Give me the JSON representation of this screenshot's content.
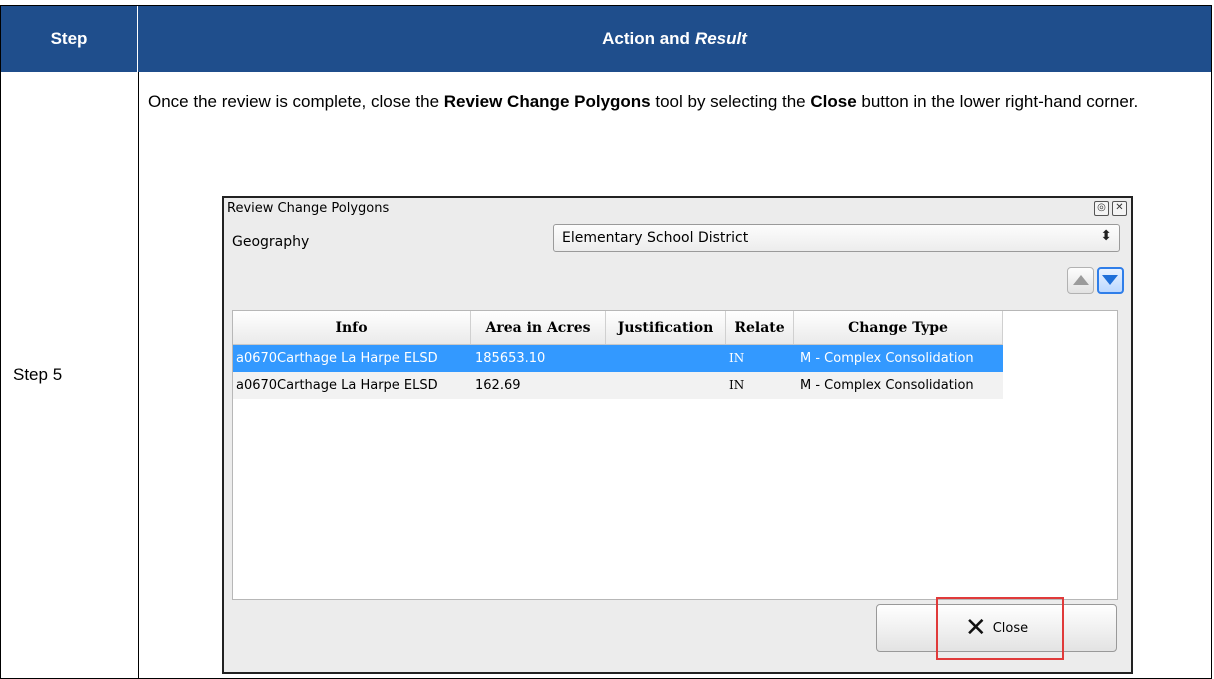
{
  "header": {
    "step_label": "Step",
    "action_label": "Action and",
    "result_label": "Result"
  },
  "row": {
    "step": "Step 5",
    "instruction": {
      "part1": "Once the review is complete, close the ",
      "bold1": "Review Change Polygons",
      "part2": " tool by selecting the ",
      "bold2": "Close",
      "part3": " button in the lower right-hand corner."
    }
  },
  "dialog": {
    "title": "Review Change Polygons",
    "controls": [
      "float-icon",
      "close-icon"
    ],
    "geography": {
      "label": "Geography",
      "value": "Elementary School District"
    },
    "table": {
      "columns": [
        "Info",
        "Area in Acres",
        "Justification",
        "Relate",
        "Change Type"
      ],
      "rows": [
        {
          "info": "a0670Carthage La Harpe ELSD",
          "area": "185653.10",
          "justification": "",
          "relate": "IN",
          "change_type": "M - Complex Consolidation",
          "selected": true
        },
        {
          "info": "a0670Carthage La Harpe ELSD",
          "area": "162.69",
          "justification": "",
          "relate": "IN",
          "change_type": "M - Complex Consolidation",
          "selected": false
        }
      ]
    },
    "close_button": {
      "label": "Close",
      "icon": "x-icon"
    }
  },
  "colors": {
    "header_bg": "#1f4e8c",
    "selection": "#3399ff",
    "highlight": "#e03a3a"
  }
}
